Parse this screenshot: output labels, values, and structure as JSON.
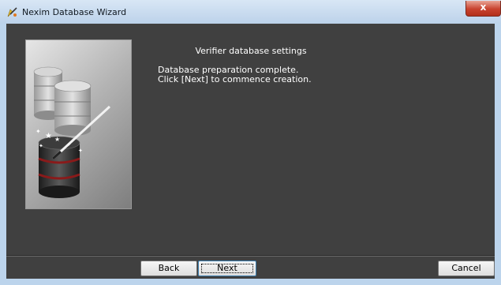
{
  "window": {
    "title": "Nexim Database Wizard",
    "close_glyph": "x"
  },
  "page": {
    "heading": "Verifier database settings",
    "message_line1": "Database preparation complete.",
    "message_line2": "Click [Next] to commence creation."
  },
  "buttons": {
    "back": "Back",
    "next": "Next",
    "cancel": "Cancel"
  },
  "icons": {
    "title_icon": "wizard-wand-icon",
    "hero": "database-wizard-illustration"
  },
  "colors": {
    "client_background": "#404040",
    "titlebar": "#bcd2ea",
    "close_button": "#c8422e",
    "text": "#ffffff"
  }
}
